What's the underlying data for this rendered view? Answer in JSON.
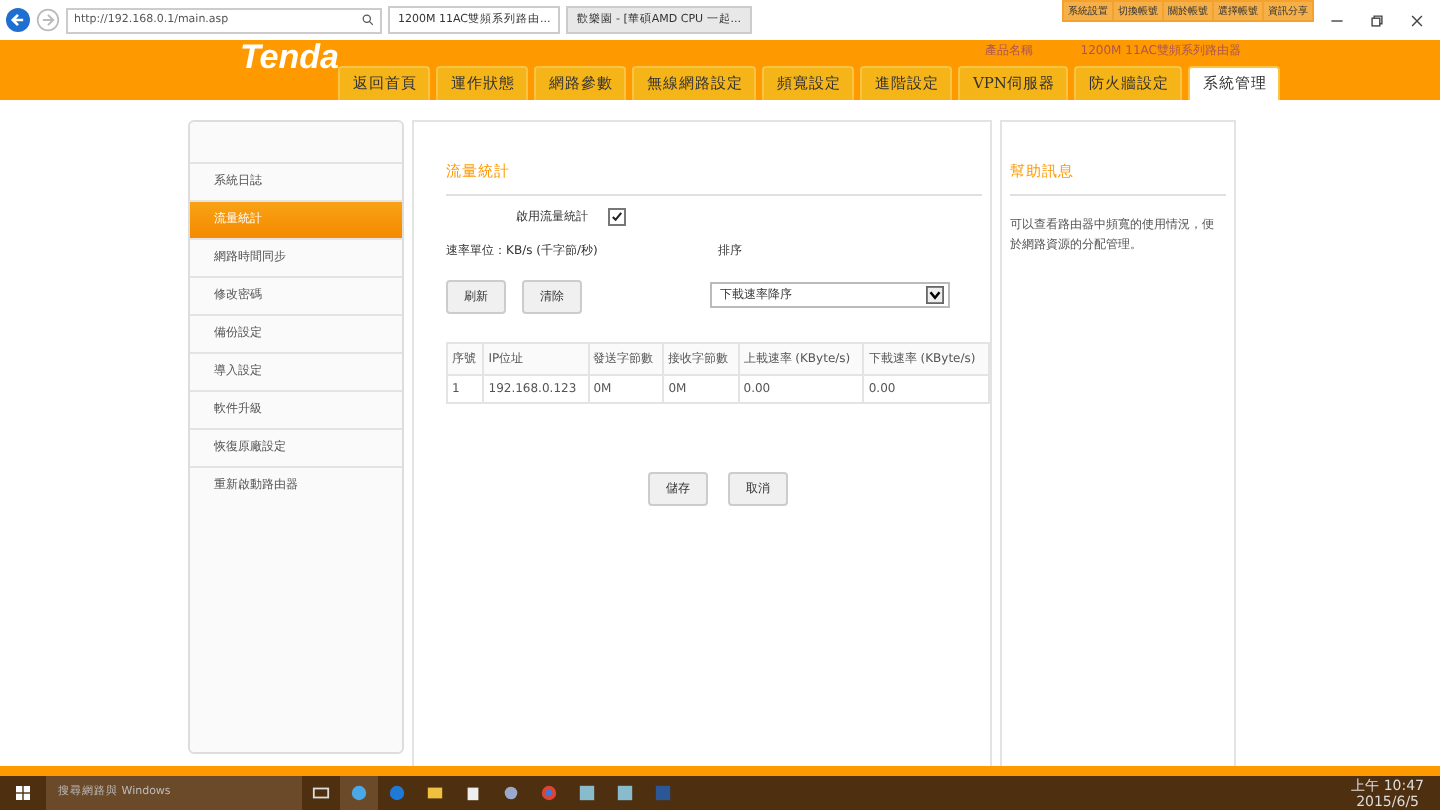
{
  "browser": {
    "address": "http://192.168.0.1/main.asp",
    "tabs": [
      {
        "title": "1200M 11AC雙頻系列路由...",
        "selected": true
      },
      {
        "title": "歡樂園 - [華碩AMD CPU 一起...",
        "selected": false
      }
    ],
    "toolbar_links": [
      "系統設置",
      "切換帳號",
      "關於帳號",
      "選擇帳號",
      "資訊分享"
    ]
  },
  "header": {
    "logo": "Tenda",
    "product_label": "產品名稱",
    "product_name": "1200M 11AC雙頻系列路由器",
    "tabs": [
      {
        "label": "返回首頁",
        "selected": false
      },
      {
        "label": "運作狀態",
        "selected": false
      },
      {
        "label": "網路參數",
        "selected": false
      },
      {
        "label": "無線網路設定",
        "selected": false
      },
      {
        "label": "頻寬設定",
        "selected": false
      },
      {
        "label": "進階設定",
        "selected": false
      },
      {
        "label": "VPN伺服器",
        "selected": false
      },
      {
        "label": "防火牆設定",
        "selected": false
      },
      {
        "label": "系統管理",
        "selected": true
      }
    ]
  },
  "sidebar": {
    "items": [
      {
        "label": "系統日誌",
        "selected": false
      },
      {
        "label": "流量統計",
        "selected": true
      },
      {
        "label": "網路時間同步",
        "selected": false
      },
      {
        "label": "修改密碼",
        "selected": false
      },
      {
        "label": "備份設定",
        "selected": false
      },
      {
        "label": "導入設定",
        "selected": false
      },
      {
        "label": "軟件升級",
        "selected": false
      },
      {
        "label": "恢復原廠設定",
        "selected": false
      },
      {
        "label": "重新啟動路由器",
        "selected": false
      }
    ]
  },
  "main": {
    "title": "流量統計",
    "enable_label": "啟用流量統計",
    "enable_checked": true,
    "unit_label": "速率單位：KB/s (千字節/秒)",
    "sort_label": "排序",
    "buttons": [
      "刷新",
      "清除"
    ],
    "sort_value": "下載速率降序",
    "table": {
      "columns": [
        "序號",
        "IP位址",
        "發送字節數",
        "接收字節數",
        "上載速率 (KByte/s)",
        "下載速率 (KByte/s)"
      ],
      "rows": [
        [
          "1",
          "192.168.0.123",
          "0M",
          "0M",
          "0.00",
          "0.00"
        ]
      ]
    },
    "footer_buttons": [
      "儲存",
      "取消"
    ]
  },
  "help": {
    "title": "幫助訊息",
    "text": "可以查看路由器中頻寬的使用情況，便於網路資源的分配管理。"
  },
  "taskbar": {
    "search_placeholder": "搜尋網路與 Windows",
    "time": "上午 10:47",
    "date": "2015/6/5"
  }
}
